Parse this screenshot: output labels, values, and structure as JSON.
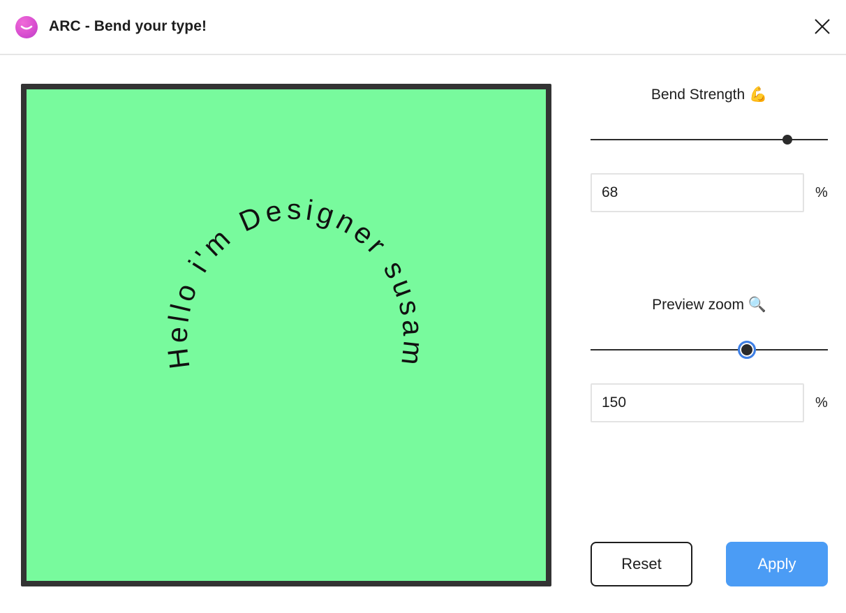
{
  "app": {
    "title": "ARC - Bend your type!",
    "logo_icon": "smile-logo-icon",
    "close_icon": "close-icon"
  },
  "preview": {
    "text": "Hello i'm Designer susam",
    "background_color": "#78fa9d",
    "frame_color": "#333333"
  },
  "controls": {
    "bend": {
      "label": "Bend Strength 💪",
      "value": "68",
      "unit": "%",
      "slider_fraction": 0.83
    },
    "zoom": {
      "label": "Preview zoom 🔍",
      "value": "150",
      "unit": "%",
      "slider_fraction": 0.66
    }
  },
  "buttons": {
    "reset_label": "Reset",
    "apply_label": "Apply",
    "apply_color": "#4b9cf5"
  }
}
